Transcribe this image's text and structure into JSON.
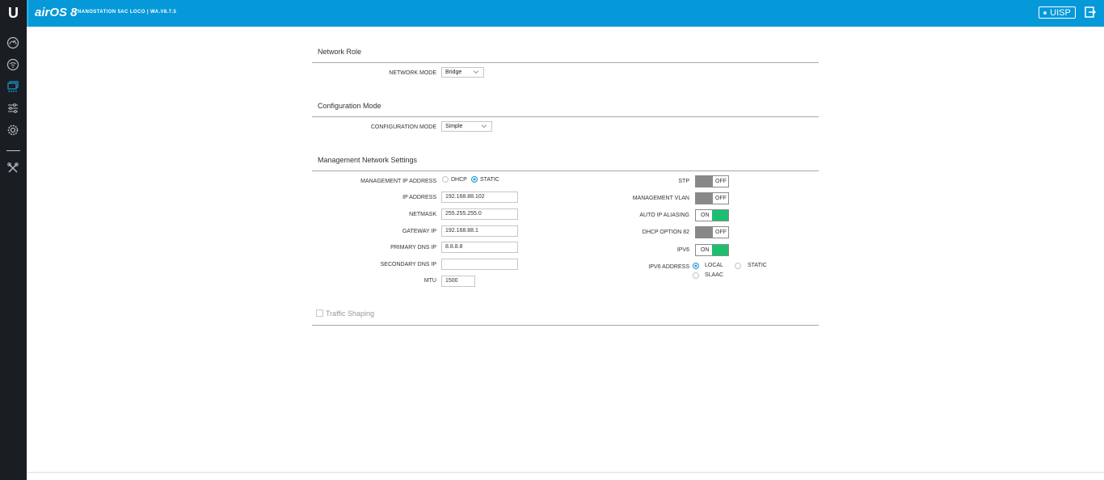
{
  "header": {
    "logo": "U",
    "brand": "airOS 8",
    "device_info": "NANOSTATION 5AC LOCO | WA.V8.7.5",
    "uisp_label": "UISP",
    "accent_color": "#0599d9",
    "logout_icon": "logout-icon"
  },
  "sidebar": {
    "items": [
      {
        "icon": "dashboard-icon"
      },
      {
        "icon": "wireless-icon"
      },
      {
        "icon": "network-icon",
        "active": true
      },
      {
        "icon": "services-icon"
      },
      {
        "icon": "system-icon"
      },
      {
        "icon": "tools-icon"
      }
    ]
  },
  "network_role": {
    "title": "Network Role",
    "network_mode_label": "NETWORK MODE",
    "network_mode_value": "Bridge"
  },
  "configuration_mode": {
    "title": "Configuration Mode",
    "configuration_mode_label": "CONFIGURATION MODE",
    "configuration_mode_value": "Simple"
  },
  "management": {
    "title": "Management Network Settings",
    "ip_address_mode_label": "MANAGEMENT IP ADDRESS",
    "dhcp_label": "DHCP",
    "static_label": "STATIC",
    "ip_mode_selected": "STATIC",
    "ip_address_label": "IP ADDRESS",
    "ip_address_value": "192.168.88.102",
    "netmask_label": "NETMASK",
    "netmask_value": "255.255.255.0",
    "gateway_label": "GATEWAY IP",
    "gateway_value": "192.168.88.1",
    "primary_dns_label": "PRIMARY DNS IP",
    "primary_dns_value": "8.8.8.8",
    "secondary_dns_label": "SECONDARY DNS IP",
    "secondary_dns_value": "",
    "mtu_label": "MTU",
    "mtu_value": "1500",
    "stp_label": "STP",
    "stp_state": "OFF",
    "mgmt_vlan_label": "MANAGEMENT VLAN",
    "mgmt_vlan_state": "OFF",
    "auto_ip_label": "AUTO IP ALIASING",
    "auto_ip_state": "ON",
    "dhcp82_label": "DHCP OPTION 82",
    "dhcp82_state": "OFF",
    "ipv6_label": "IPV6",
    "ipv6_state": "ON",
    "ipv6_address_label": "IPV6 ADDRESS",
    "ipv6_local_label": "LOCAL",
    "ipv6_static_label": "STATIC",
    "ipv6_slaac_label": "SLAAC",
    "ipv6_selected": "LOCAL",
    "on_color": "#1dbf6f",
    "off_color": "#888888"
  },
  "traffic_shaping": {
    "label": "Traffic Shaping",
    "checked": false
  }
}
